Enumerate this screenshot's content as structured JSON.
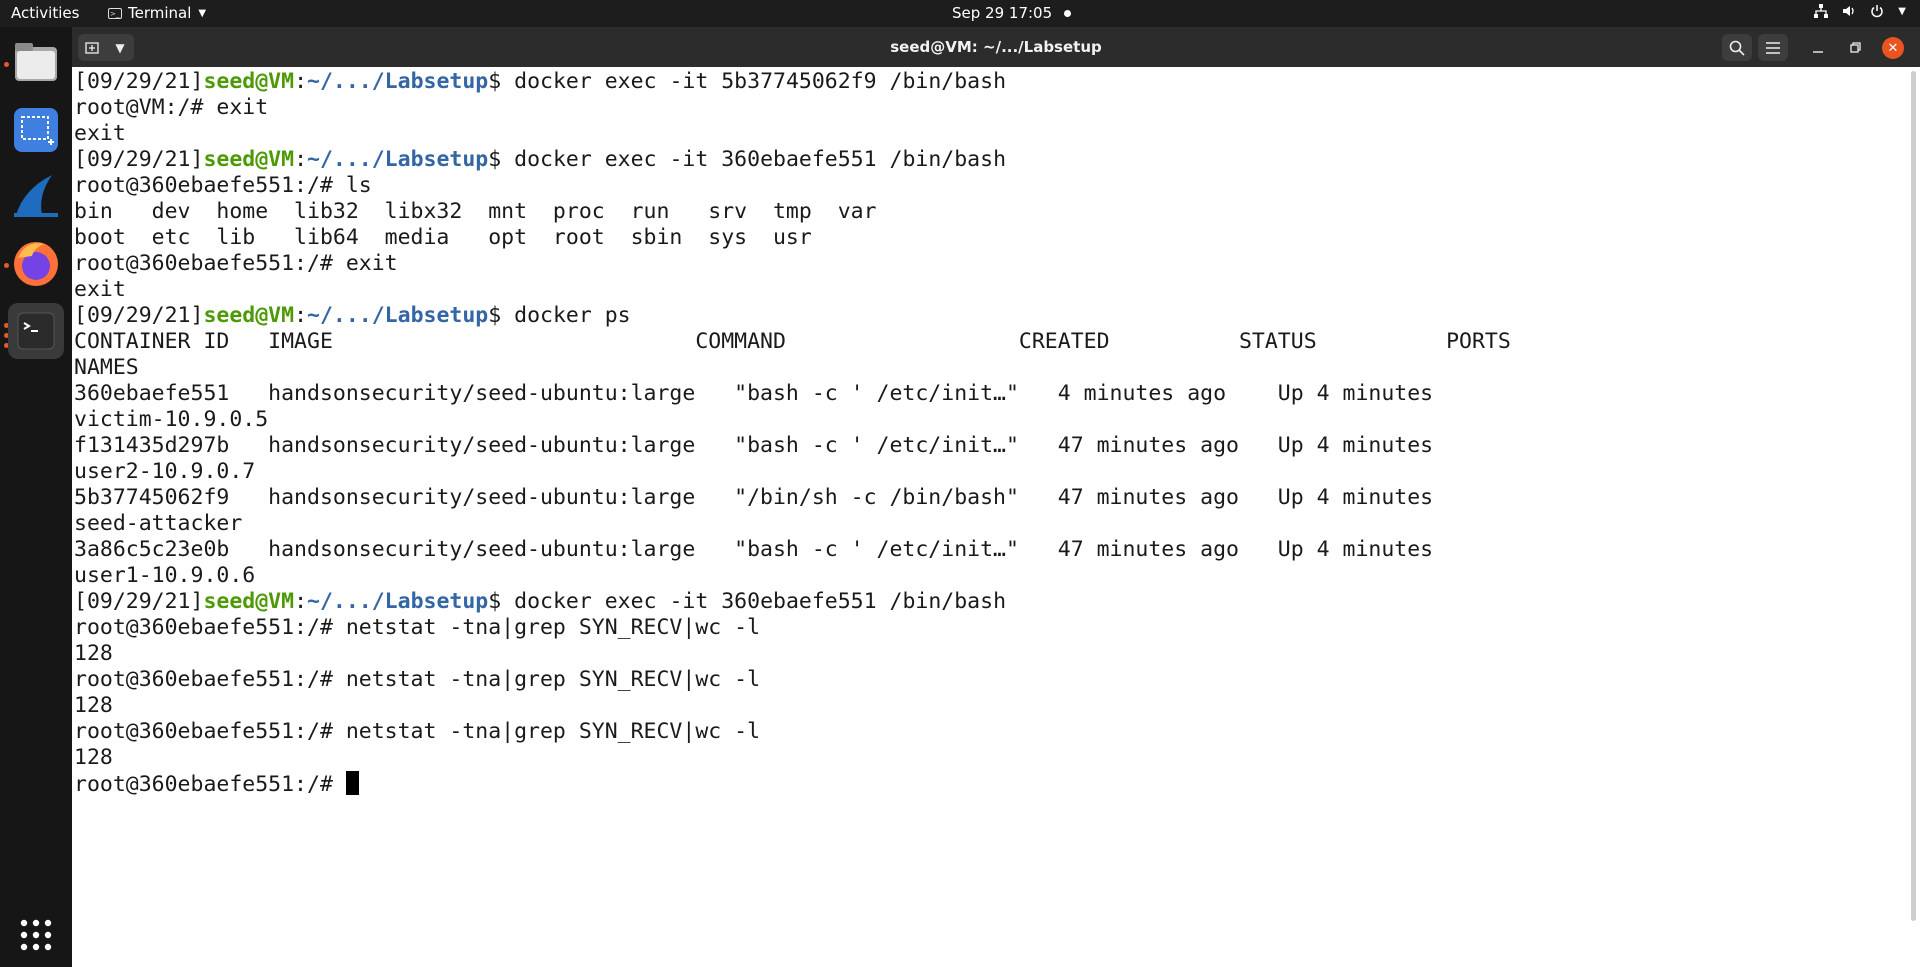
{
  "topbar": {
    "activities": "Activities",
    "app_name": "Terminal",
    "clock": "Sep 29  17:05"
  },
  "dock": {
    "items": [
      "files-icon",
      "screenshot-icon",
      "wireshark-icon",
      "firefox-icon",
      "terminal-icon"
    ],
    "show_apps_icon": "grid-icon"
  },
  "window": {
    "title": "seed@VM: ~/.../Labsetup"
  },
  "terminal": {
    "lines": [
      {
        "prompt": true,
        "date": "[09/29/21]",
        "user": "seed@VM",
        "path": "~/.../Labsetup",
        "cmd": " docker exec -it 5b37745062f9 /bin/bash"
      },
      {
        "text": "root@VM:/# exit"
      },
      {
        "text": "exit"
      },
      {
        "prompt": true,
        "date": "[09/29/21]",
        "user": "seed@VM",
        "path": "~/.../Labsetup",
        "cmd": " docker exec -it 360ebaefe551 /bin/bash"
      },
      {
        "text": "root@360ebaefe551:/# ls"
      },
      {
        "text": "bin   dev  home  lib32  libx32  mnt  proc  run   srv  tmp  var"
      },
      {
        "text": "boot  etc  lib   lib64  media   opt  root  sbin  sys  usr"
      },
      {
        "text": "root@360ebaefe551:/# exit"
      },
      {
        "text": "exit"
      },
      {
        "prompt": true,
        "date": "[09/29/21]",
        "user": "seed@VM",
        "path": "~/.../Labsetup",
        "cmd": " docker ps"
      },
      {
        "text": "CONTAINER ID   IMAGE                            COMMAND                  CREATED          STATUS          PORTS"
      },
      {
        "text": "NAMES"
      },
      {
        "text": "360ebaefe551   handsonsecurity/seed-ubuntu:large   \"bash -c ' /etc/init…\"   4 minutes ago    Up 4 minutes"
      },
      {
        "text": "victim-10.9.0.5"
      },
      {
        "text": "f131435d297b   handsonsecurity/seed-ubuntu:large   \"bash -c ' /etc/init…\"   47 minutes ago   Up 4 minutes"
      },
      {
        "text": "user2-10.9.0.7"
      },
      {
        "text": "5b37745062f9   handsonsecurity/seed-ubuntu:large   \"/bin/sh -c /bin/bash\"   47 minutes ago   Up 4 minutes"
      },
      {
        "text": "seed-attacker"
      },
      {
        "text": "3a86c5c23e0b   handsonsecurity/seed-ubuntu:large   \"bash -c ' /etc/init…\"   47 minutes ago   Up 4 minutes"
      },
      {
        "text": "user1-10.9.0.6"
      },
      {
        "prompt": true,
        "date": "[09/29/21]",
        "user": "seed@VM",
        "path": "~/.../Labsetup",
        "cmd": " docker exec -it 360ebaefe551 /bin/bash"
      },
      {
        "text": "root@360ebaefe551:/# netstat -tna|grep SYN_RECV|wc -l"
      },
      {
        "text": "128"
      },
      {
        "text": "root@360ebaefe551:/# netstat -tna|grep SYN_RECV|wc -l"
      },
      {
        "text": "128"
      },
      {
        "text": "root@360ebaefe551:/# netstat -tna|grep SYN_RECV|wc -l"
      },
      {
        "text": "128"
      },
      {
        "text": "root@360ebaefe551:/# ",
        "cursor": true
      }
    ]
  },
  "colors": {
    "prompt_user": "#4e9a06",
    "prompt_path": "#3465a4",
    "close_button": "#e95420"
  }
}
